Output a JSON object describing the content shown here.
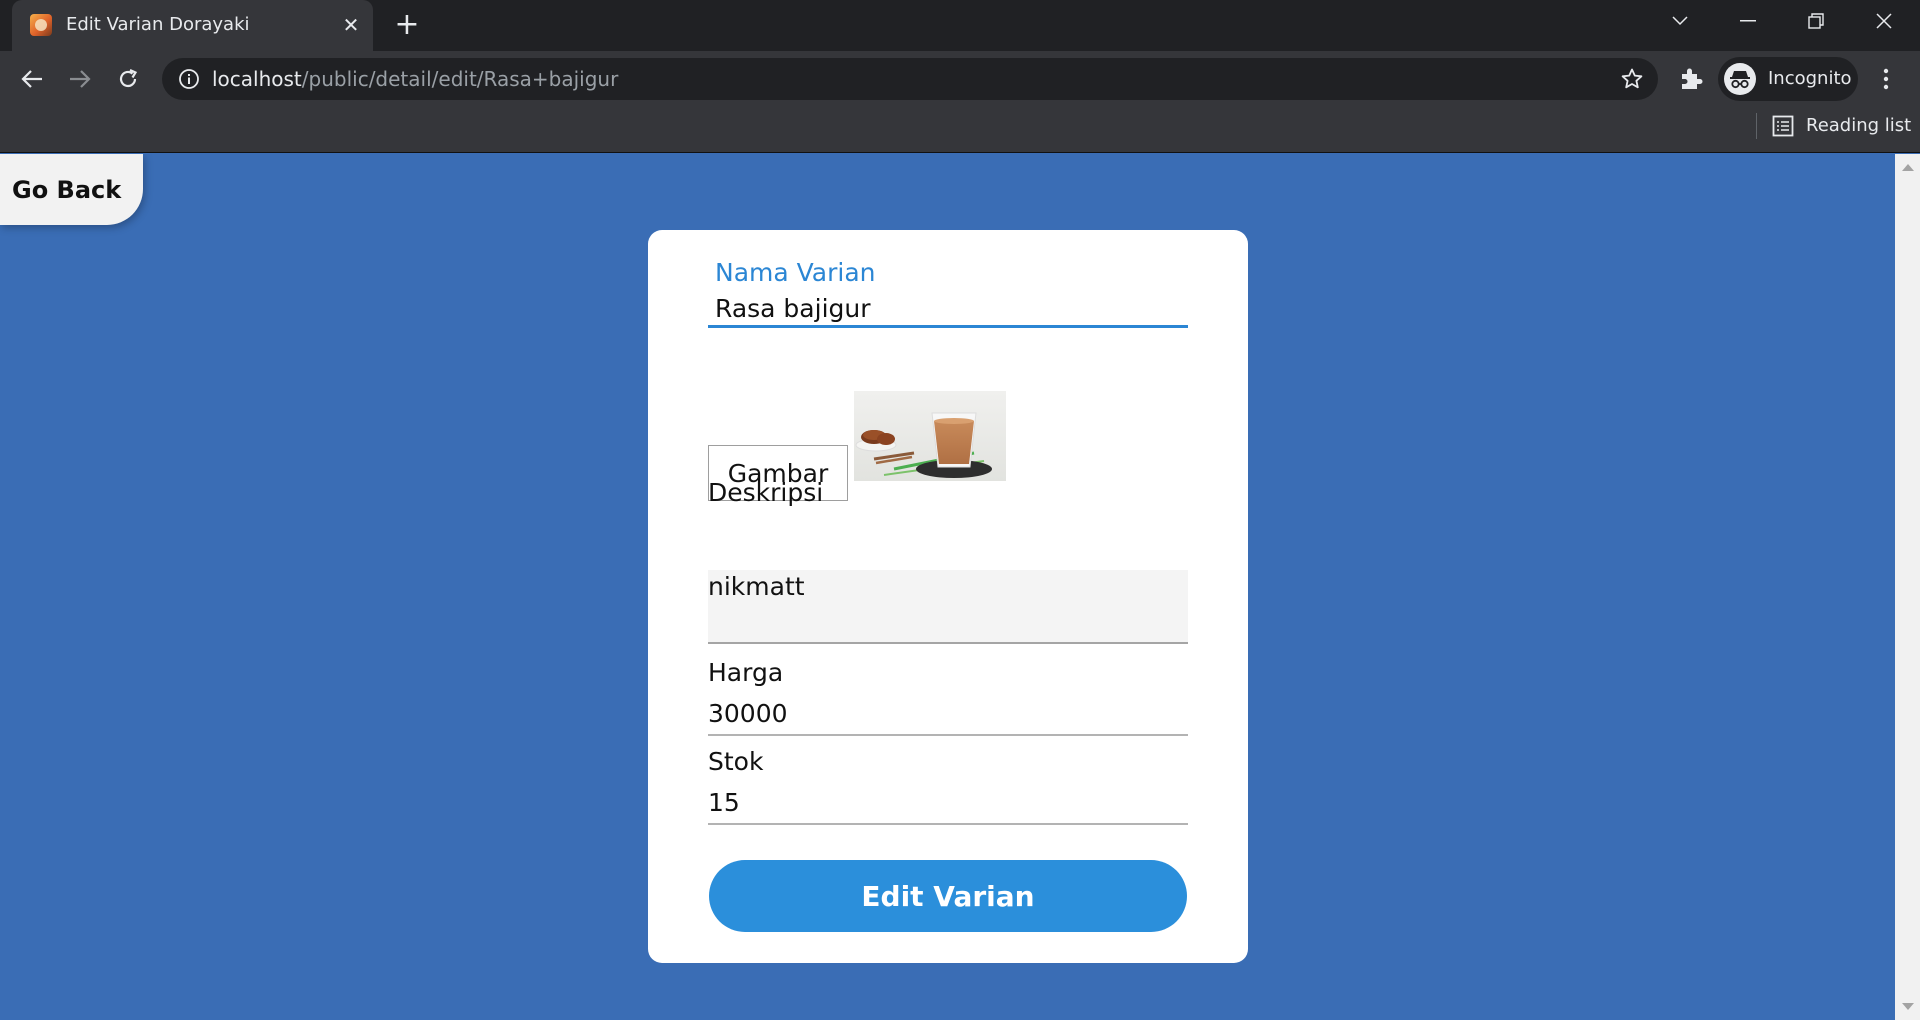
{
  "browser": {
    "tab_title": "Edit Varian Dorayaki",
    "url_host": "localhost",
    "url_path": "/public/detail/edit/Rasa+bajigur",
    "incognito_label": "Incognito",
    "reading_list_label": "Reading list"
  },
  "page": {
    "go_back_label": "Go Back",
    "form": {
      "name_label": "Nama Varian",
      "name_value": "Rasa bajigur",
      "image_button_label": "Gambar",
      "description_label": "Deskripsi",
      "description_value": "nikmatt",
      "price_label": "Harga",
      "price_value": "30000",
      "stock_label": "Stok",
      "stock_value": "15",
      "submit_label": "Edit Varian"
    }
  },
  "colors": {
    "page_background": "#3a6db5",
    "accent": "#2b86d4",
    "button": "#2b8fdb"
  }
}
